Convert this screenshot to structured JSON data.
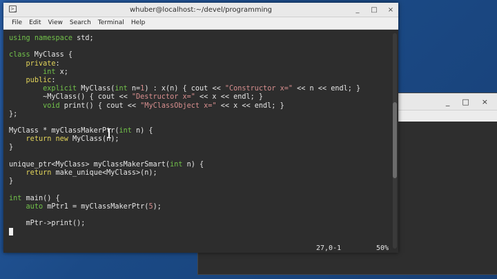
{
  "window": {
    "title": "whuber@localhost:~/devel/programming",
    "app_icon_glyph": ">_",
    "controls": {
      "minimize": "_",
      "maximize": "□",
      "close": "×"
    }
  },
  "menu": {
    "file": "File",
    "edit": "Edit",
    "view": "View",
    "search": "Search",
    "terminal": "Terminal",
    "help": "Help"
  },
  "background_window": {
    "controls": {
      "minimize": "_",
      "maximize": "□",
      "close": "×"
    }
  },
  "code": {
    "l1": {
      "a": "using",
      "b": " ",
      "c": "namespace",
      "d": " std;"
    },
    "l3": {
      "a": "class",
      "b": " MyClass {"
    },
    "l4": {
      "a": "    ",
      "b": "private",
      "c": ":"
    },
    "l5": {
      "a": "        ",
      "b": "int",
      "c": " x;"
    },
    "l6": {
      "a": "    ",
      "b": "public",
      "c": ":"
    },
    "l7": {
      "a": "        ",
      "b": "explicit",
      "c": " MyClass(",
      "d": "int",
      "e": " n=",
      "f": "1",
      "g": ") : x(n) { cout << ",
      "h": "\"Constructor x=\"",
      "i": " << n << endl; }"
    },
    "l8": {
      "a": "        ~MyClass() { cout << ",
      "b": "\"Destructor x=\"",
      "c": " << x << endl; }"
    },
    "l9": {
      "a": "        ",
      "b": "void",
      "c": " print() { cout << ",
      "d": "\"MyClassObject x=\"",
      "e": " << x << endl; }"
    },
    "l10": {
      "a": "};"
    },
    "l12": {
      "a": "MyClass * myClassMakerPtr(",
      "b": "int",
      "c": " n) {"
    },
    "l13": {
      "a": "    ",
      "b": "return",
      "c": " ",
      "d": "new",
      "e": " MyClass(n);"
    },
    "l14": {
      "a": "}"
    },
    "l16": {
      "a": "unique_ptr<MyClass> myClassMakerSmart(",
      "b": "int",
      "c": " n) {"
    },
    "l17": {
      "a": "    ",
      "b": "return",
      "c": " make_unique<MyClass>(n);"
    },
    "l18": {
      "a": "}"
    },
    "l20": {
      "a": "int",
      "b": " main() {"
    },
    "l21": {
      "a": "    ",
      "b": "auto",
      "c": " mPtr1 = myClassMakerPtr(",
      "d": "5",
      "e": ");"
    },
    "l23": {
      "a": "    mPtr->print();"
    }
  },
  "status": {
    "position": "27,0-1",
    "percent": "50%"
  }
}
